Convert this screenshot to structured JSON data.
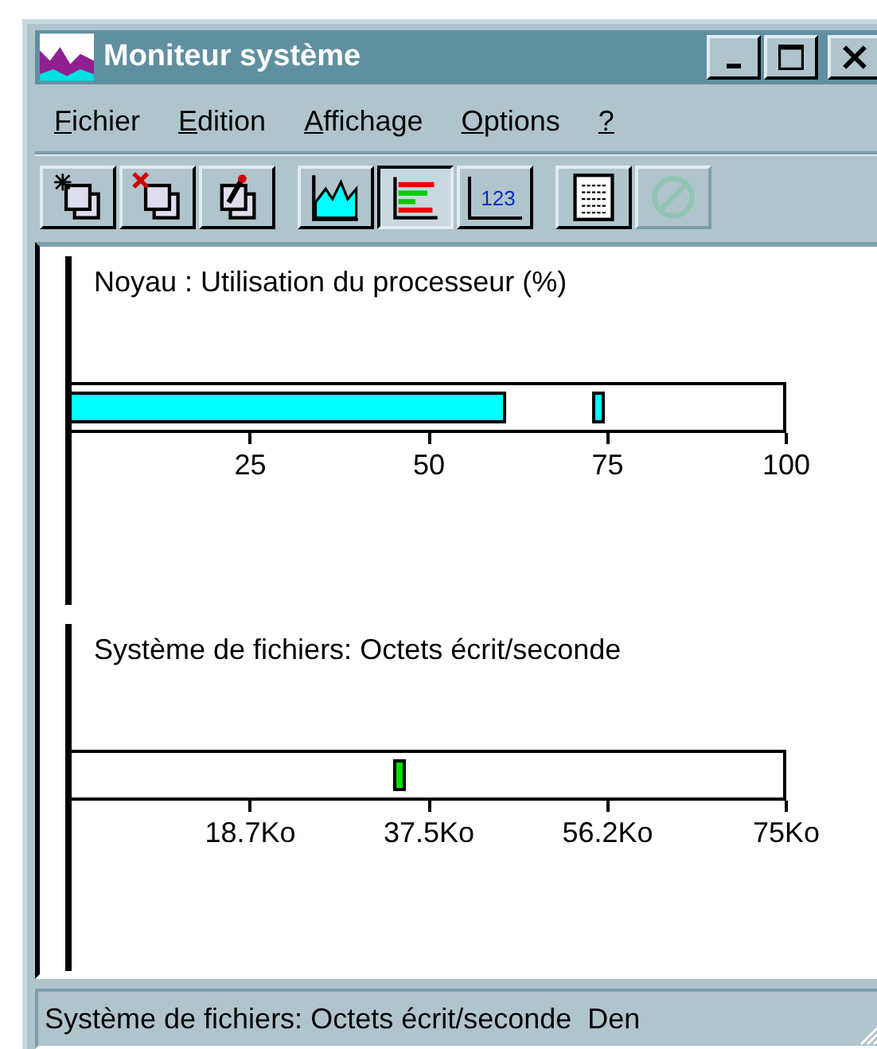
{
  "window": {
    "title": "Moniteur système"
  },
  "menu": [
    {
      "label": "Fichier"
    },
    {
      "label": "Edition"
    },
    {
      "label": "Affichage"
    },
    {
      "label": "Options"
    },
    {
      "label": "?"
    }
  ],
  "toolbar": [
    [
      {
        "kind": "add",
        "selected": false,
        "disabled": false
      },
      {
        "kind": "remove",
        "selected": false,
        "disabled": false
      },
      {
        "kind": "edit",
        "selected": false,
        "disabled": false
      }
    ],
    [
      {
        "kind": "line",
        "selected": false,
        "disabled": false
      },
      {
        "kind": "bar",
        "selected": true,
        "disabled": false
      },
      {
        "kind": "numeric",
        "label": "123",
        "selected": false,
        "disabled": false
      }
    ],
    [
      {
        "kind": "sheet",
        "selected": false,
        "disabled": false
      },
      {
        "kind": "stop",
        "selected": false,
        "disabled": true
      }
    ]
  ],
  "meters": [
    {
      "title": "Noyau : Utilisation du processeur (%)",
      "color": "#00ffff",
      "current": {
        "level": 0.61
      },
      "peak": {
        "level": 0.74
      },
      "ticks": [
        "25",
        "50",
        "75",
        "100"
      ]
    },
    {
      "title": "Système de fichiers: Octets écrit/seconde",
      "color": "#00e000",
      "peak": {
        "level": 0.46
      },
      "ticks": [
        "18.7Ko",
        "37.5Ko",
        "56.2Ko",
        "75Ko"
      ]
    }
  ],
  "status_bar": {
    "text": "Système de fichiers: Octets écrit/seconde  Den"
  }
}
